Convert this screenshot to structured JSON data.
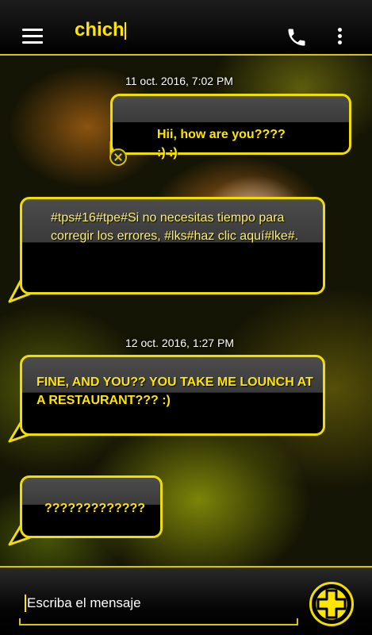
{
  "header": {
    "title": "chich",
    "menu_icon": "hamburger-menu-icon",
    "call_icon": "phone-icon",
    "more_icon": "more-vertical-icon"
  },
  "messages": [
    {
      "type": "timestamp",
      "text": "11 oct. 2016, 7:02 PM"
    },
    {
      "type": "outgoing",
      "text": "Hii, how are you????\n:)  :)",
      "status_icon": "cancel-icon"
    },
    {
      "type": "incoming",
      "text": "#tps#16#tpe#Si no necesitas tiempo para corregir los errores, #lks#haz clic aquí#lke#."
    },
    {
      "type": "timestamp",
      "text": "12 oct. 2016, 1:27 PM"
    },
    {
      "type": "incoming",
      "text": "FINE, AND YOU?? YOU TAKE ME LOUNCH AT A RESTAURANT???  :)"
    },
    {
      "type": "incoming",
      "text": "?????????????"
    }
  ],
  "compose": {
    "placeholder": "Escriba el mensaje",
    "add_icon": "plus-icon"
  },
  "colors": {
    "accent": "#f0de00",
    "text_accent": "#ffe600",
    "bar": "#000000"
  }
}
